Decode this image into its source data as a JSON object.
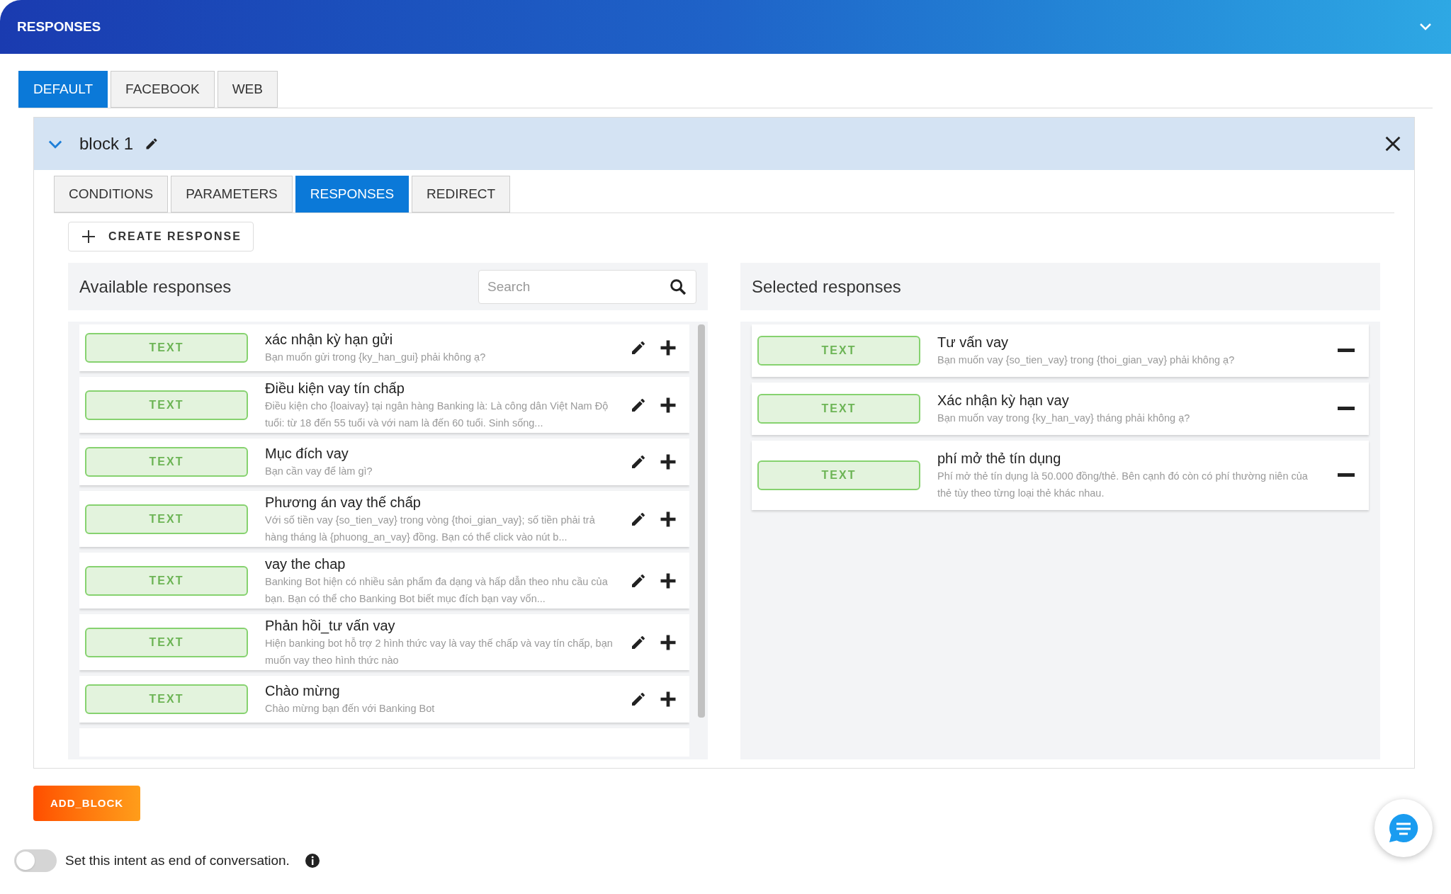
{
  "header": {
    "title": "RESPONSES"
  },
  "channel_tabs": [
    {
      "label": "DEFAULT",
      "selected": true
    },
    {
      "label": "FACEBOOK",
      "selected": false
    },
    {
      "label": "WEB",
      "selected": false
    }
  ],
  "block": {
    "name": "block 1",
    "expanded": true,
    "tabs": [
      {
        "label": "CONDITIONS",
        "selected": false
      },
      {
        "label": "PARAMETERS",
        "selected": false
      },
      {
        "label": "RESPONSES",
        "selected": true
      },
      {
        "label": "REDIRECT",
        "selected": false
      }
    ],
    "create_button": "CREATE RESPONSE",
    "available": {
      "title": "Available responses",
      "search": {
        "placeholder": "Search"
      },
      "items": [
        {
          "type": "TEXT",
          "title": "xác nhận kỳ hạn gửi",
          "text": "Bạn muốn gửi trong {ky_han_gui} phải không ạ?"
        },
        {
          "type": "TEXT",
          "title": "Điều kiện vay tín chấp",
          "text": "Điều kiện cho {loaivay} tại ngân hàng Banking là: Là công dân Việt Nam Độ tuổi: từ 18 đến 55 tuổi và với nam là đến 60 tuổi. Sinh sống..."
        },
        {
          "type": "TEXT",
          "title": "Mục đích vay",
          "text": "Bạn cần vay để làm gì?"
        },
        {
          "type": "TEXT",
          "title": "Phương án vay thế chấp",
          "text": "Với số tiền vay {so_tien_vay} trong vòng {thoi_gian_vay}; số tiền phải trả hàng tháng là {phuong_an_vay} đồng. Bạn có thể click vào nút b..."
        },
        {
          "type": "TEXT",
          "title": "vay the chap",
          "text": "Banking Bot hiện có nhiều sản phẩm đa dạng và hấp dẫn theo nhu cầu của bạn. Bạn có thể cho Banking Bot biết mục đích bạn vay vốn..."
        },
        {
          "type": "TEXT",
          "title": "Phản hồi_tư vấn vay",
          "text": "Hiện banking bot hỗ trợ 2 hình thức vay là vay thế chấp và vay tín chấp, bạn muốn vay theo hình thức nào"
        },
        {
          "type": "TEXT",
          "title": "Chào mừng",
          "text": "Chào mừng bạn đến với Banking Bot"
        }
      ]
    },
    "selected": {
      "title": "Selected responses",
      "items": [
        {
          "type": "TEXT",
          "title": "Tư vấn vay",
          "text": "Bạn muốn vay {so_tien_vay} trong {thoi_gian_vay} phải không ạ?"
        },
        {
          "type": "TEXT",
          "title": "Xác nhận kỳ hạn vay",
          "text": "Bạn muốn vay trong {ky_han_vay} tháng phải không ạ?"
        },
        {
          "type": "TEXT",
          "title": "phí mở thẻ tín dụng",
          "text": "Phí mở thẻ tín dụng là 50.000 đồng/thẻ. Bên cạnh đó còn có phí thường niên của thẻ tùy theo từng loại thẻ khác nhau."
        }
      ]
    }
  },
  "add_block_button": "ADD_BLOCK",
  "end_toggle": {
    "label": "Set this intent as end of conversation.",
    "on": false
  }
}
